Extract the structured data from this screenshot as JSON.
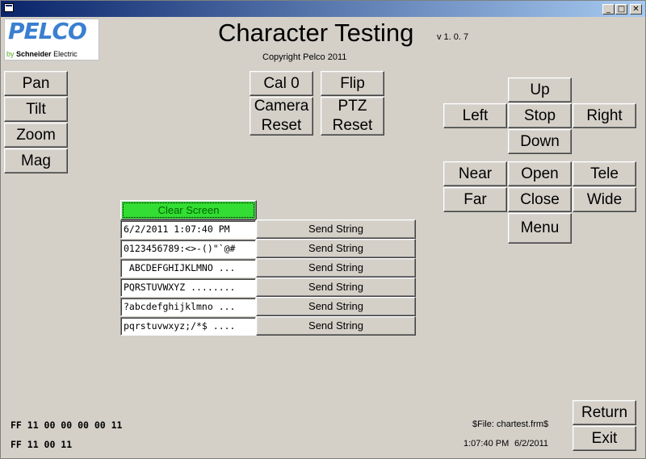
{
  "title": "Character Testing",
  "version": "v 1. 0. 7",
  "copyright": "Copyright Pelco 2011",
  "logo": {
    "brand": "PELCO",
    "by": "by",
    "company": "Schneider",
    "company2": "Electric"
  },
  "caption_buttons": {
    "minimize": "_",
    "maximize": "□",
    "close": "✕"
  },
  "left_buttons": {
    "pan": "Pan",
    "tilt": "Tilt",
    "zoom": "Zoom",
    "mag": "Mag"
  },
  "center_buttons": {
    "cal0": "Cal 0",
    "flip": "Flip",
    "camera_reset": "Camera\nReset",
    "ptz_reset": "PTZ\nReset"
  },
  "ptz": {
    "up": "Up",
    "left": "Left",
    "stop": "Stop",
    "right": "Right",
    "down": "Down",
    "near": "Near",
    "open": "Open",
    "tele": "Tele",
    "far": "Far",
    "close": "Close",
    "wide": "Wide",
    "menu": "Menu"
  },
  "clear_screen": "Clear Screen",
  "strings": [
    {
      "value": "6/2/2011 1:07:40 PM",
      "button": "Send String"
    },
    {
      "value": "0123456789:<>-()\"`@#",
      "button": "Send String"
    },
    {
      "value": " ABCDEFGHIJKLMNO ...",
      "button": "Send String"
    },
    {
      "value": "PQRSTUVWXYZ ........",
      "button": "Send String"
    },
    {
      "value": "?abcdefghijklmno ...",
      "button": "Send String"
    },
    {
      "value": "pqrstuvwxyz;/*$ ....",
      "button": "Send String"
    }
  ],
  "hex1": "FF 11 00 00 00 00 11",
  "hex2": "FF 11 00 11",
  "file_label": "$File: chartest.frm$",
  "time": "1:07:40 PM",
  "date": "6/2/2011",
  "bottom_buttons": {
    "return": "Return",
    "exit": "Exit"
  },
  "colors": {
    "face": "#d4d0c8",
    "clear_screen": "#33dd33",
    "title_bar": "#0a246a"
  }
}
